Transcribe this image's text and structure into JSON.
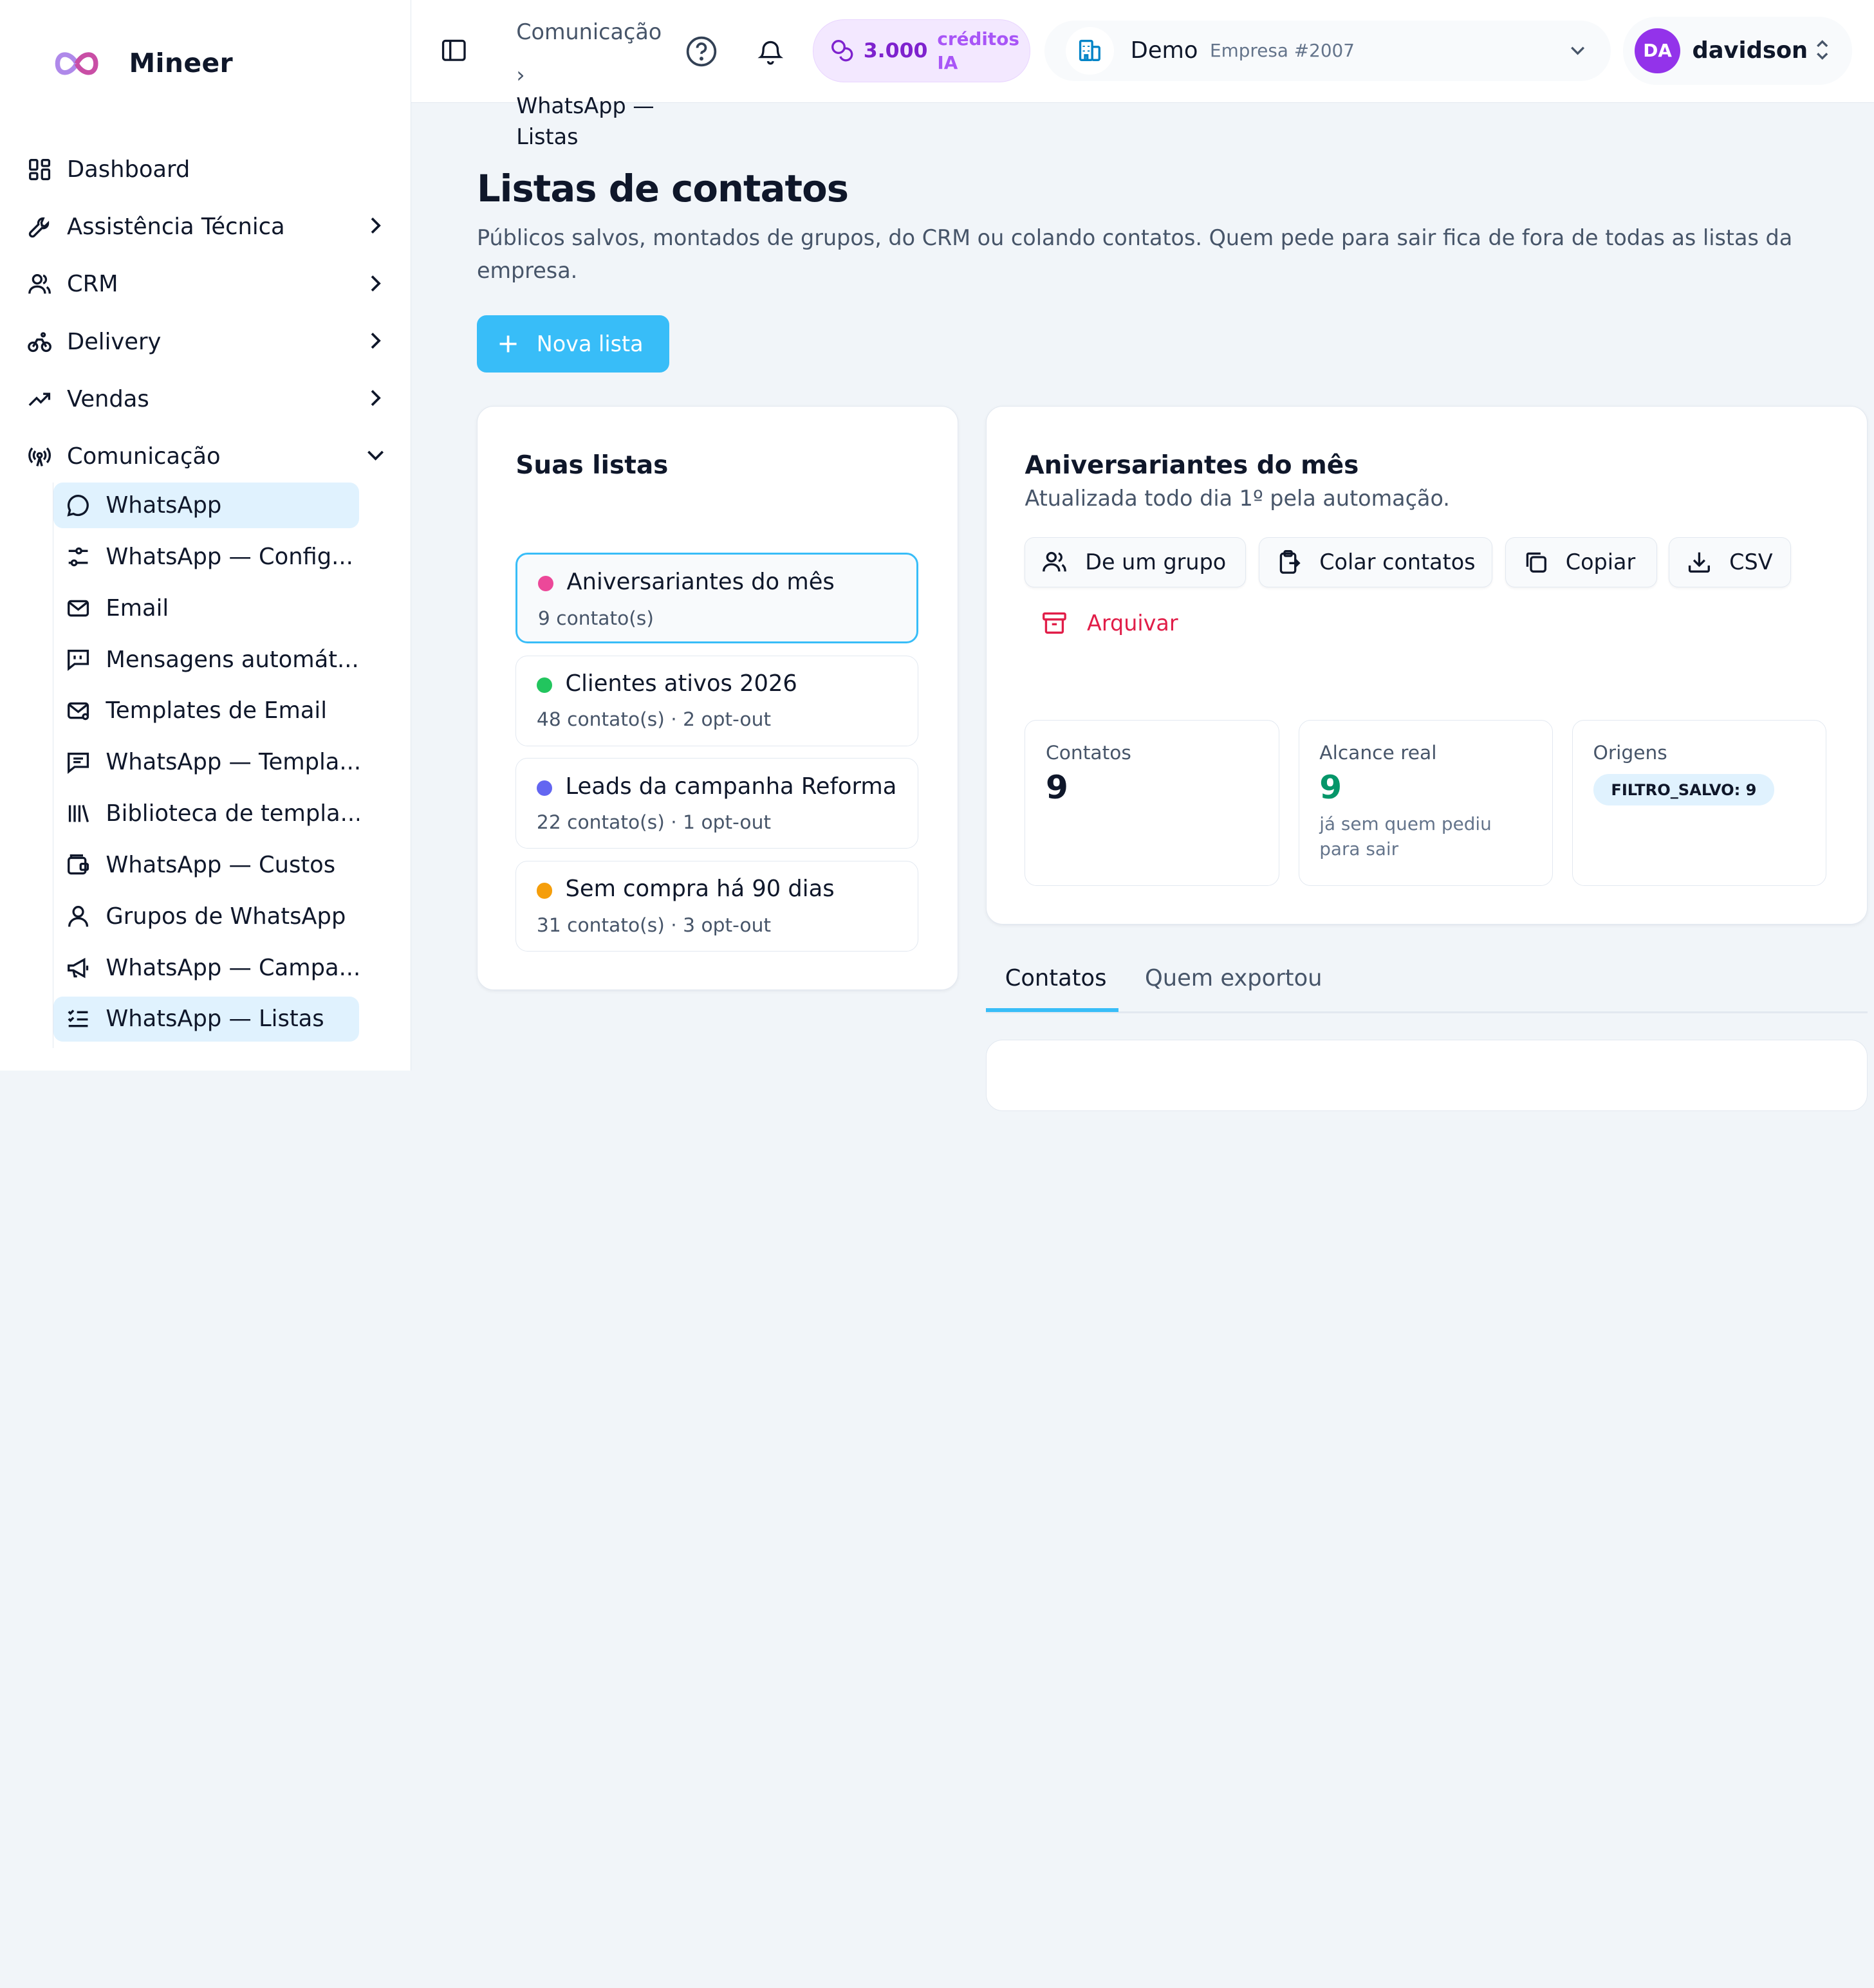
{
  "brand": {
    "name": "Mineer"
  },
  "sidebar": {
    "items": [
      {
        "label": "Dashboard"
      },
      {
        "label": "Assistência Técnica"
      },
      {
        "label": "CRM"
      },
      {
        "label": "Delivery"
      },
      {
        "label": "Vendas"
      },
      {
        "label": "Comunicação"
      }
    ],
    "sub_items": [
      {
        "label": "WhatsApp"
      },
      {
        "label": "WhatsApp — Config..."
      },
      {
        "label": "Email"
      },
      {
        "label": "Mensagens automát..."
      },
      {
        "label": "Templates de Email"
      },
      {
        "label": "WhatsApp — Templa..."
      },
      {
        "label": "Biblioteca de templa..."
      },
      {
        "label": "WhatsApp — Custos"
      },
      {
        "label": "Grupos de WhatsApp"
      },
      {
        "label": "WhatsApp — Campa..."
      },
      {
        "label": "WhatsApp — Listas"
      }
    ]
  },
  "header": {
    "breadcrumb": {
      "parent": "Comunicação",
      "separator": "›",
      "current": "WhatsApp — Listas"
    },
    "credits": {
      "amount": "3.000",
      "label": "créditos IA"
    },
    "company": {
      "name": "Demo",
      "id": "Empresa #2007"
    },
    "user": {
      "initials": "DA",
      "name": "davidson"
    }
  },
  "main": {
    "title": "Listas de contatos",
    "description": "Públicos salvos, montados de grupos, do CRM ou colando contatos. Quem pede para sair fica de fora de todas as listas da empresa.",
    "new_list_label": "Nova lista",
    "lists_card": {
      "title": "Suas listas",
      "lists": [
        {
          "name": "Aniversariantes do mês",
          "meta": "9 contato(s)",
          "color": "#ec4899"
        },
        {
          "name": "Clientes ativos 2026",
          "meta": "48 contato(s) · 2 opt-out",
          "color": "#22c55e"
        },
        {
          "name": "Leads da campanha Reforma",
          "meta": "22 contato(s) · 1 opt-out",
          "color": "#6366f1"
        },
        {
          "name": "Sem compra há 90 dias",
          "meta": "31 contato(s) · 3 opt-out",
          "color": "#f59e0b"
        }
      ]
    },
    "detail": {
      "title": "Aniversariantes do mês",
      "subtitle": "Atualizada todo dia 1º pela automação.",
      "actions": {
        "from_group": "De um grupo",
        "paste": "Colar contatos",
        "copy": "Copiar",
        "csv": "CSV",
        "archive": "Arquivar"
      },
      "stats": {
        "contacts_label": "Contatos",
        "contacts_value": "9",
        "reach_label": "Alcance real",
        "reach_value": "9",
        "reach_note": "já sem quem pediu para sair",
        "origins_label": "Origens",
        "origins_badge": "FILTRO_SALVO: 9"
      }
    },
    "tabs": [
      {
        "label": "Contatos"
      },
      {
        "label": "Quem exportou"
      }
    ]
  },
  "colors": {
    "accent": "#38bdf8",
    "brand_purple": "#9333ea",
    "danger": "#e11d48",
    "success": "#059669"
  }
}
